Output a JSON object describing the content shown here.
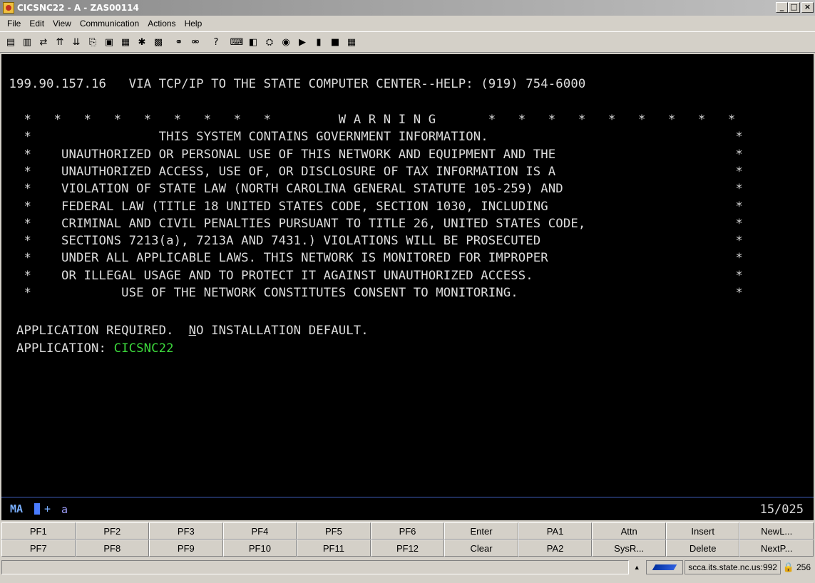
{
  "window": {
    "title": "CICSNC22 - A - ZAS00114",
    "controls": {
      "minimize": "_",
      "maximize": "□",
      "close": "×"
    }
  },
  "menu": [
    "File",
    "Edit",
    "View",
    "Communication",
    "Actions",
    "Help"
  ],
  "toolbar": {
    "icons": [
      {
        "name": "print-screen-icon",
        "glyph": "▤"
      },
      {
        "name": "print-icon",
        "glyph": "▥"
      },
      {
        "name": "transfer-icon",
        "glyph": "⇄"
      },
      {
        "name": "send-icon",
        "glyph": "⇈"
      },
      {
        "name": "receive-icon",
        "glyph": "⇊"
      },
      {
        "name": "copy-icon",
        "glyph": "⎘"
      },
      {
        "name": "paste-icon",
        "glyph": "▣"
      },
      {
        "name": "edit-icon",
        "glyph": "▦"
      },
      {
        "name": "macro-icon",
        "glyph": "✱"
      },
      {
        "name": "display-icon",
        "glyph": "▩"
      },
      {
        "name": "connect-icon",
        "glyph": "⚭"
      },
      {
        "name": "disconnect-icon",
        "glyph": "⚮"
      },
      {
        "name": "help-icon",
        "glyph": "?"
      },
      {
        "name": "keyboard-icon",
        "glyph": "⌨"
      },
      {
        "name": "color-icon",
        "glyph": "◧"
      },
      {
        "name": "settings-icon",
        "glyph": "⛭"
      },
      {
        "name": "record-icon",
        "glyph": "◉"
      },
      {
        "name": "play-icon",
        "glyph": "▶"
      },
      {
        "name": "pause-icon",
        "glyph": "▮"
      },
      {
        "name": "stop-icon",
        "glyph": "■"
      },
      {
        "name": "grid-icon",
        "glyph": "▦"
      }
    ]
  },
  "terminal": {
    "header": " 199.90.157.16   VIA TCP/IP TO THE STATE COMPUTER CENTER--HELP: (919) 754-6000",
    "warning_lines": [
      "   *   *   *   *   *   *   *   *   *         W A R N I N G       *   *   *   *   *   *   *   *   *",
      "   *                 THIS SYSTEM CONTAINS GOVERNMENT INFORMATION.                                 *",
      "   *    UNAUTHORIZED OR PERSONAL USE OF THIS NETWORK AND EQUIPMENT AND THE                        *",
      "   *    UNAUTHORIZED ACCESS, USE OF, OR DISCLOSURE OF TAX INFORMATION IS A                        *",
      "   *    VIOLATION OF STATE LAW (NORTH CAROLINA GENERAL STATUTE 105-259) AND                       *",
      "   *    FEDERAL LAW (TITLE 18 UNITED STATES CODE, SECTION 1030, INCLUDING                         *",
      "   *    CRIMINAL AND CIVIL PENALTIES PURSUANT TO TITLE 26, UNITED STATES CODE,                    *",
      "   *    SECTIONS 7213(a), 7213A AND 7431.) VIOLATIONS WILL BE PROSECUTED                          *",
      "   *    UNDER ALL APPLICABLE LAWS. THIS NETWORK IS MONITORED FOR IMPROPER                         *",
      "   *    OR ILLEGAL USAGE AND TO PROTECT IT AGAINST UNAUTHORIZED ACCESS.                           *",
      "   *            USE OF THE NETWORK CONSTITUTES CONSENT TO MONITORING.                             *"
    ],
    "app_required_prefix": "  APPLICATION REQUIRED.  ",
    "app_required_underlined": "N",
    "app_required_suffix": "O INSTALLATION DEFAULT.",
    "app_label": "  APPLICATION: ",
    "app_value": "CICSNC22"
  },
  "oia": {
    "mode": "MA",
    "plus": "+",
    "indicator": "a",
    "cursor_position": "15/025"
  },
  "function_keys": [
    "PF1",
    "PF2",
    "PF3",
    "PF4",
    "PF5",
    "PF6",
    "Enter",
    "PA1",
    "Attn",
    "Insert",
    "NewL...",
    "PF7",
    "PF8",
    "PF9",
    "PF10",
    "PF11",
    "PF12",
    "Clear",
    "PA2",
    "SysR...",
    "Delete",
    "NextP..."
  ],
  "statusbar": {
    "arrow": "▲",
    "host": "scca.its.state.nc.us:992",
    "lock_glyph": "🔒",
    "encryption_bits": "256"
  }
}
